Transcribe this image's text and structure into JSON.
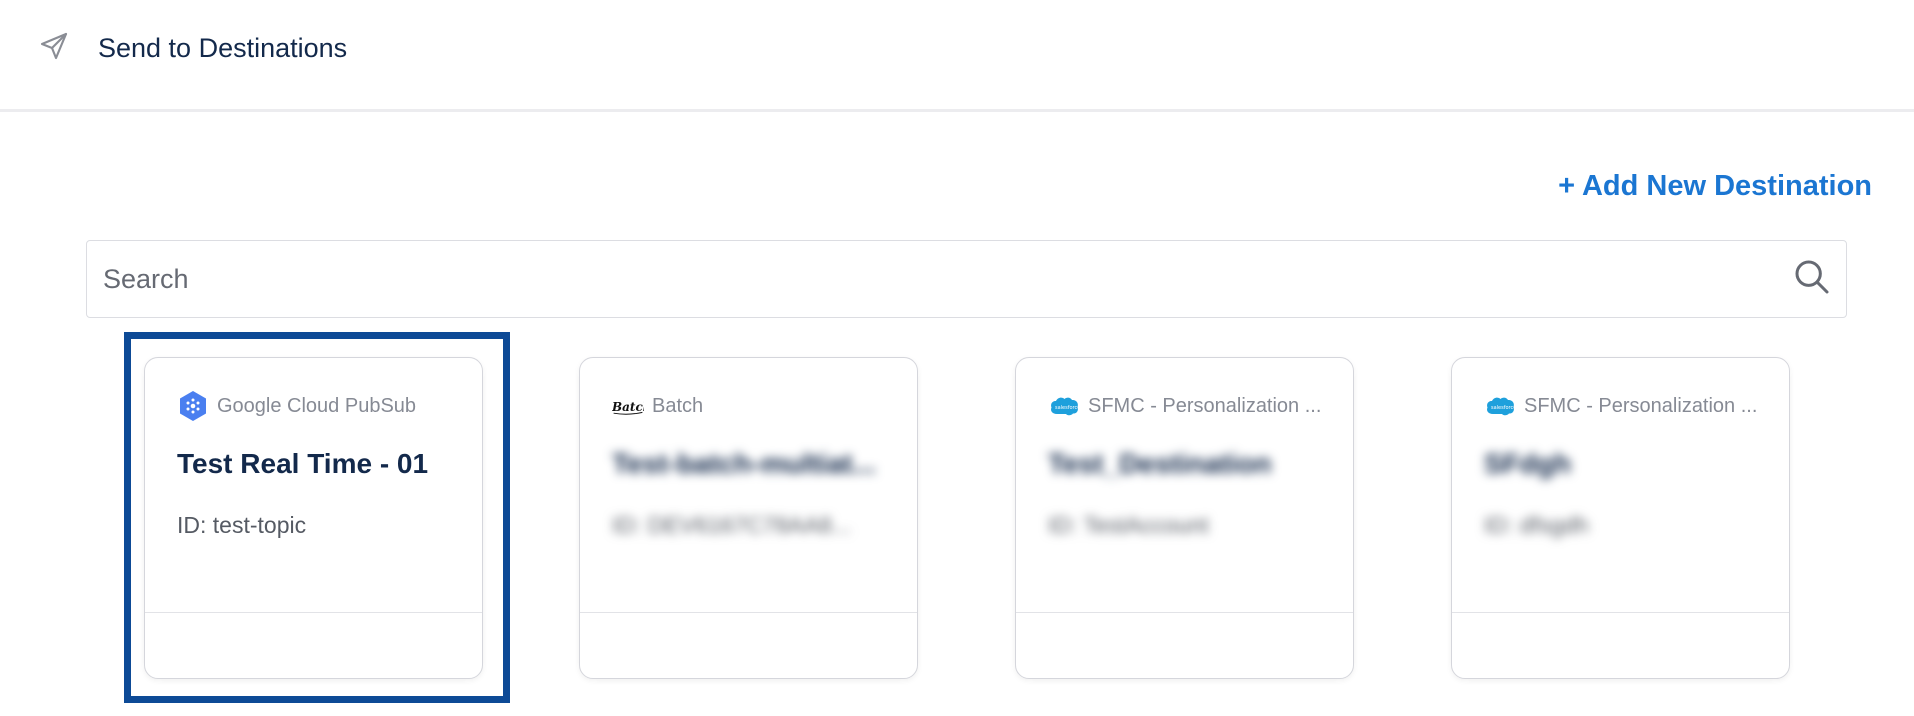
{
  "header": {
    "title": "Send to Destinations",
    "icon": "send-icon"
  },
  "actions": {
    "add_destination_label": "+ Add New Destination",
    "accent_color": "#1b76d2"
  },
  "search": {
    "placeholder": "Search",
    "value": ""
  },
  "cards": [
    {
      "type": "Google Cloud PubSub",
      "logo": "google-cloud-pubsub-logo",
      "name": "Test Real Time - 01",
      "id": "ID: test-topic",
      "selected": true,
      "blurred": false
    },
    {
      "type": "Batch",
      "logo": "batch-logo",
      "name": "Test-batch-multiat...",
      "id": "ID: DEV6167C78AA8...",
      "selected": false,
      "blurred": true
    },
    {
      "type": "SFMC - Personalization ...",
      "logo": "salesforce-logo",
      "name": "Test_Destination",
      "id": "ID: TestAccount",
      "selected": false,
      "blurred": true
    },
    {
      "type": "SFMC - Personalization ...",
      "logo": "salesforce-logo",
      "name": "SFdgh",
      "id": "ID: dfsgdh",
      "selected": false,
      "blurred": true
    }
  ],
  "colors": {
    "title": "#13294b",
    "selection_border": "#0d4a96"
  }
}
